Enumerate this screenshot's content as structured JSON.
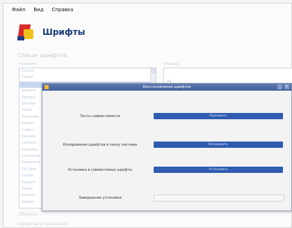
{
  "menubar": {
    "file": "Файл",
    "view": "Вид",
    "help": "Справка"
  },
  "header": {
    "title": "Шрифты"
  },
  "section_label": "Список шрифтов",
  "columns": {
    "name": "Название",
    "preview": "Образец"
  },
  "font_list": [
    "Courier",
    "Corbel",
    "Arial",
    "Verdana",
    "Georgia",
    "Tahoma",
    "Times",
    "Trebuchet",
    "Impact",
    "Calibri",
    "Candara",
    "Cambria",
    "Consolas",
    "Constantia",
    "Garamond",
    "Gill Sans",
    "Lucida",
    "Palatino",
    "Segoe",
    "Symbol",
    "Sylfaen"
  ],
  "preview": {
    "text": "Аа"
  },
  "bottom_label": "Образец",
  "status": "Шрифтов установлено",
  "dialog": {
    "title": "Восстановление шрифтов",
    "rows": [
      {
        "label": "Тесты совместимости",
        "button": "Проверить"
      },
      {
        "label": "Копирование шрифтов в папку системы",
        "button": "Копировать"
      },
      {
        "label": "Установка в совместимые шрифты",
        "button": "Установить"
      },
      {
        "label": "Завершение установки",
        "button": ""
      }
    ]
  },
  "colors": {
    "accent": "#2f5bb0",
    "title_bar": "#3f5f9c",
    "app_title": "#163a78"
  },
  "icons": {
    "app": "fonts-app-icon",
    "dialog": "dialog-app-icon"
  }
}
